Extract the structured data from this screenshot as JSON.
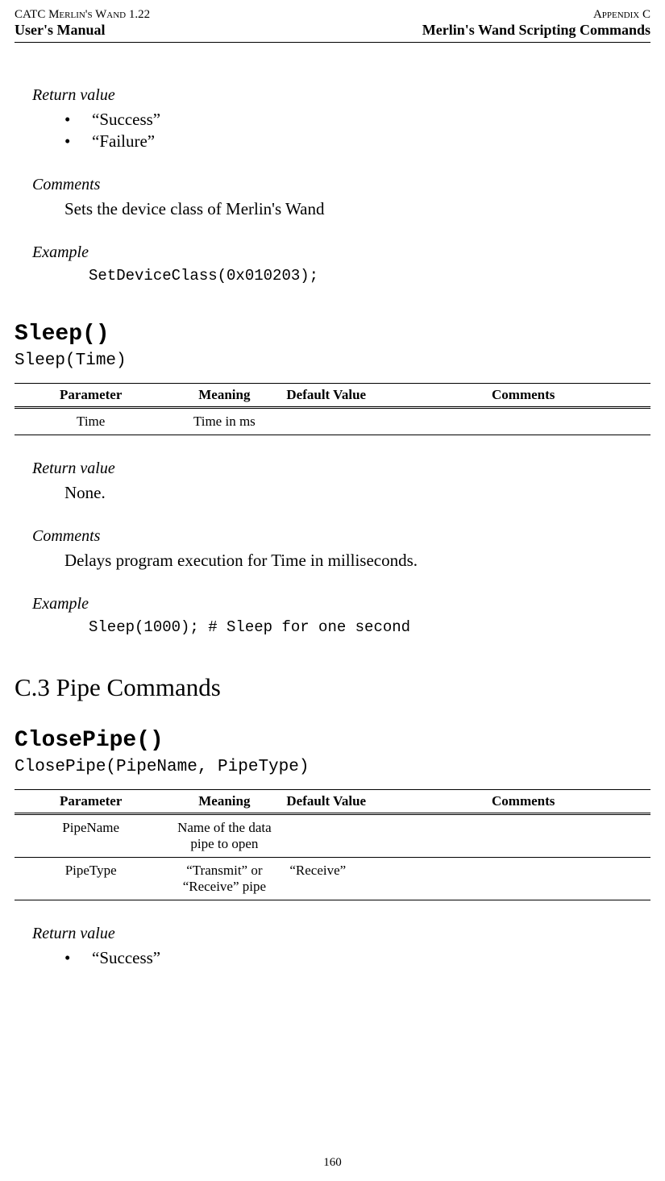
{
  "header": {
    "top_left": "CATC Merlin's Wand 1.22",
    "top_right": "Appendix C",
    "line2_left": "User's Manual",
    "line2_right": "Merlin's Wand Scripting Commands"
  },
  "sec1": {
    "return_heading": "Return value",
    "bullets": [
      "“Success”",
      "“Failure”"
    ],
    "comments_heading": "Comments",
    "comments_body": "Sets the device class of Merlin's Wand",
    "example_heading": "Example",
    "example_code": "SetDeviceClass(0x010203);"
  },
  "cmd_sleep": {
    "name": "Sleep()",
    "signature": "Sleep(Time)",
    "table_headers": [
      "Parameter",
      "Meaning",
      "Default Value",
      "Comments"
    ],
    "rows": [
      {
        "param": "Time",
        "meaning": "Time in ms",
        "default": "",
        "comments": ""
      }
    ],
    "return_heading": "Return value",
    "return_body": "None.",
    "comments_heading": "Comments",
    "comments_body": "Delays program execution for Time in milliseconds.",
    "example_heading": "Example",
    "example_code": "Sleep(1000); # Sleep for one second"
  },
  "section_c3": "C.3   Pipe Commands",
  "cmd_closepipe": {
    "name": "ClosePipe()",
    "signature": "ClosePipe(PipeName, PipeType)",
    "table_headers": [
      "Parameter",
      "Meaning",
      "Default Value",
      "Comments"
    ],
    "rows": [
      {
        "param": "PipeName",
        "meaning": "Name of the data pipe to open",
        "default": "",
        "comments": ""
      },
      {
        "param": "PipeType",
        "meaning": "“Transmit” or “Receive” pipe",
        "default": "“Receive”",
        "comments": ""
      }
    ],
    "return_heading": "Return value",
    "bullets": [
      "“Success”"
    ]
  },
  "page_number": "160"
}
